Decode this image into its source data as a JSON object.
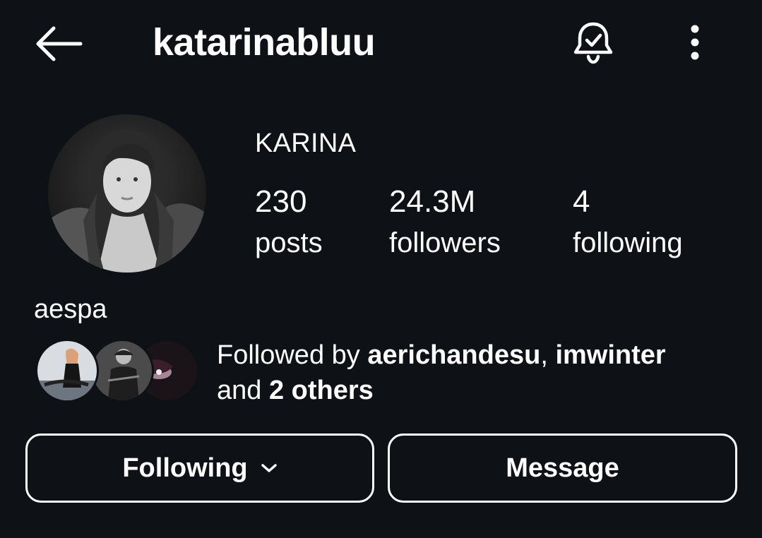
{
  "header": {
    "username": "katarinabluu",
    "back_icon": "arrow-left-icon",
    "notifications_icon": "bell-check-icon",
    "more_icon": "more-vertical-icon"
  },
  "profile": {
    "display_name": "KARINA",
    "bio": "aespa",
    "stats": {
      "posts": {
        "value": "230",
        "label": "posts"
      },
      "followers": {
        "value": "24.3M",
        "label": "followers"
      },
      "following": {
        "value": "4",
        "label": "following"
      }
    }
  },
  "followed_by": {
    "prefix": "Followed by ",
    "user1": "aerichandesu",
    "separator": ", ",
    "user2": "imwinter",
    "and_text": "and ",
    "others": "2 others"
  },
  "actions": {
    "following_label": "Following",
    "message_label": "Message"
  },
  "colors": {
    "background": "#0e1115",
    "text": "#ffffff"
  }
}
